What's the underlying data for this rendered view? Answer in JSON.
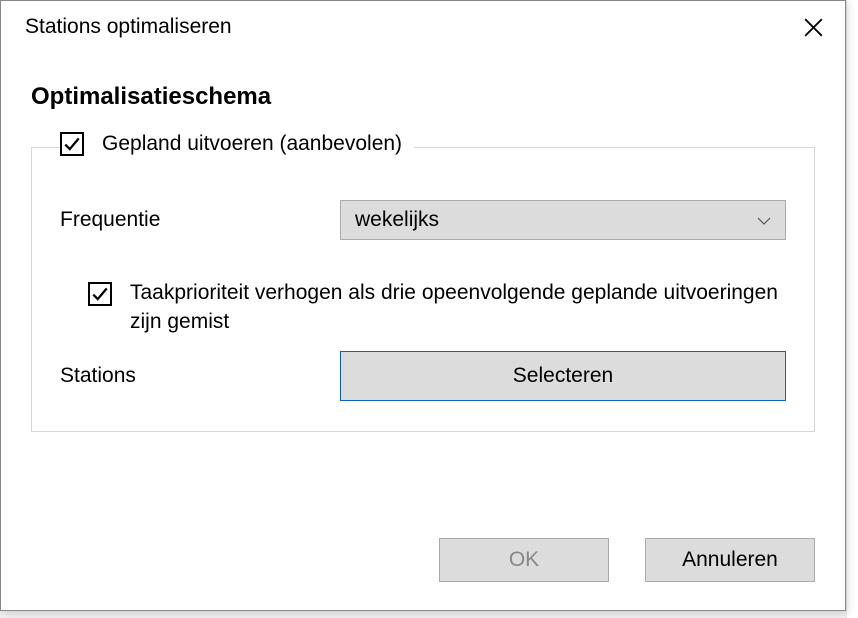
{
  "dialog": {
    "title": "Stations optimaliseren",
    "heading": "Optimalisatieschema",
    "scheduled_run": {
      "label": "Gepland uitvoeren (aanbevolen)",
      "checked": true
    },
    "frequency": {
      "label": "Frequentie",
      "value": "wekelijks"
    },
    "priority": {
      "label": "Taakprioriteit verhogen als drie opeenvolgende geplande uitvoeringen zijn gemist",
      "checked": true
    },
    "stations": {
      "label": "Stations",
      "button": "Selecteren"
    },
    "buttons": {
      "ok": "OK",
      "cancel": "Annuleren"
    }
  }
}
